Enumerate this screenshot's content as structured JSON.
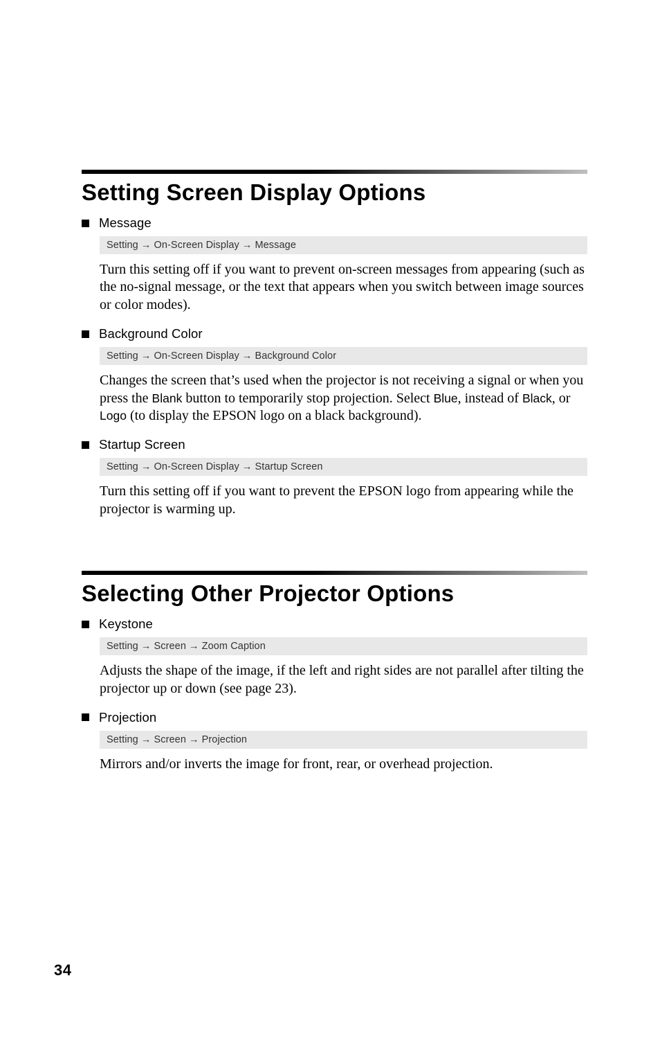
{
  "sections": [
    {
      "title": "Setting Screen Display Options",
      "items": [
        {
          "title": "Message",
          "path": [
            "Setting",
            "On-Screen Display",
            "Message"
          ],
          "body": "Turn this setting off if you want to prevent on-screen messages from appearing (such as the no-signal message, or the text that appears when you switch between image sources or color modes)."
        },
        {
          "title": "Background Color",
          "path": [
            "Setting",
            "On-Screen Display",
            "Background Color"
          ],
          "body_html": "Changes the screen that’s used when the projector is not receiving a signal or when you press the <span class='ss'>Blank</span> button to temporarily stop projection. Select <span class='ss'>Blue</span>, instead of <span class='ss'>Black</span>, or <span class='ss'>Logo</span> (to display the EPSON logo on a black background)."
        },
        {
          "title": "Startup Screen",
          "path": [
            "Setting",
            "On-Screen Display",
            "Startup Screen"
          ],
          "body": "Turn this setting off if you want to prevent the EPSON logo from appearing while the projector is warming up."
        }
      ]
    },
    {
      "title": "Selecting Other Projector Options",
      "items": [
        {
          "title": "Keystone",
          "path": [
            "Setting",
            "Screen",
            "Zoom Caption"
          ],
          "body": "Adjusts the shape of the image, if the left and right sides are not parallel after tilting the projector up or down (see page 23)."
        },
        {
          "title": "Projection",
          "path": [
            "Setting",
            "Screen",
            "Projection"
          ],
          "body": "Mirrors and/or inverts the image for front, rear, or overhead projection."
        }
      ]
    }
  ],
  "page_number": "34",
  "arrow": "→"
}
